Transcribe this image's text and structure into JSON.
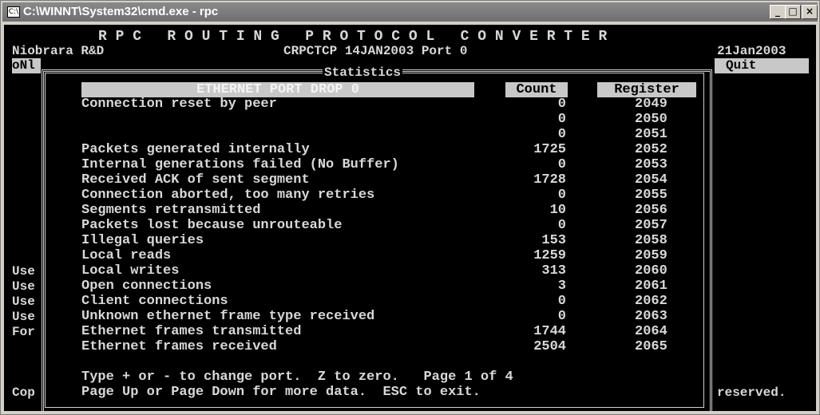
{
  "window": {
    "title": "C:\\WINNT\\System32\\cmd.exe - rpc",
    "icon": "console-icon",
    "minimize": "_",
    "maximize": "□",
    "close": "×"
  },
  "header": {
    "banner": "R P C   R O U T I N G   P R O T O C O L   C O N V E R T E R",
    "company": "Niobrara R&D",
    "version": "CRPCTCP 14JAN2003 Port 0",
    "date": "21Jan2003"
  },
  "side": {
    "left_top": "oNl",
    "right_top": "Quit",
    "left_items": [
      "Use",
      "Use",
      "Use",
      "Use",
      "For"
    ],
    "left_bottom": "Cop",
    "right_bottom": "reserved."
  },
  "stats": {
    "title": "Statistics",
    "section": "ETHERNET PORT DROP 0",
    "count_header": "Count",
    "register_header": "Register",
    "rows": [
      {
        "label": "Connection reset by peer",
        "count": "0",
        "register": "2049"
      },
      {
        "label": "",
        "count": "0",
        "register": "2050"
      },
      {
        "label": "",
        "count": "0",
        "register": "2051"
      },
      {
        "label": "Packets generated internally",
        "count": "1725",
        "register": "2052"
      },
      {
        "label": "Internal generations failed (No Buffer)",
        "count": "0",
        "register": "2053"
      },
      {
        "label": "Received ACK of sent segment",
        "count": "1728",
        "register": "2054"
      },
      {
        "label": "Connection aborted, too many retries",
        "count": "0",
        "register": "2055"
      },
      {
        "label": "Segments retransmitted",
        "count": "10",
        "register": "2056"
      },
      {
        "label": "Packets lost because unrouteable",
        "count": "0",
        "register": "2057"
      },
      {
        "label": "Illegal queries",
        "count": "153",
        "register": "2058"
      },
      {
        "label": "Local reads",
        "count": "1259",
        "register": "2059"
      },
      {
        "label": "Local writes",
        "count": "313",
        "register": "2060"
      },
      {
        "label": "Open connections",
        "count": "3",
        "register": "2061"
      },
      {
        "label": "Client connections",
        "count": "0",
        "register": "2062"
      },
      {
        "label": "Unknown ethernet frame type received",
        "count": "0",
        "register": "2063"
      },
      {
        "label": "Ethernet frames transmitted",
        "count": "1744",
        "register": "2064"
      },
      {
        "label": "Ethernet frames received",
        "count": "2504",
        "register": "2065"
      }
    ],
    "help_line1": "Type + or - to change port.  Z to zero.   Page 1 of 4",
    "help_line2": "Page Up or Page Down for more data.  ESC to exit."
  }
}
